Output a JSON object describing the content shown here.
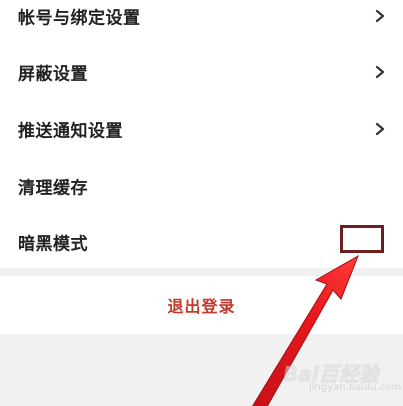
{
  "settings": {
    "items": [
      {
        "label": "帐号与绑定设置",
        "has_chevron": true
      },
      {
        "label": "屏蔽设置",
        "has_chevron": true
      },
      {
        "label": "推送通知设置",
        "has_chevron": true
      },
      {
        "label": "清理缓存",
        "has_chevron": false
      },
      {
        "label": "暗黑模式",
        "has_toggle": true,
        "toggle_on": false
      }
    ]
  },
  "logout": {
    "label": "退出登录"
  },
  "annotation": {
    "highlight_color": "#6b1f1f",
    "arrow_color": "#e8191a"
  },
  "watermark": {
    "logo_text": "Bai百经验",
    "sub_text": "jingyan.baidu.com"
  },
  "colors": {
    "logout_text": "#c0392b",
    "background": "#f1f1f1",
    "list_background": "#ffffff"
  },
  "icons": {
    "chevron": "chevron-right-icon"
  }
}
